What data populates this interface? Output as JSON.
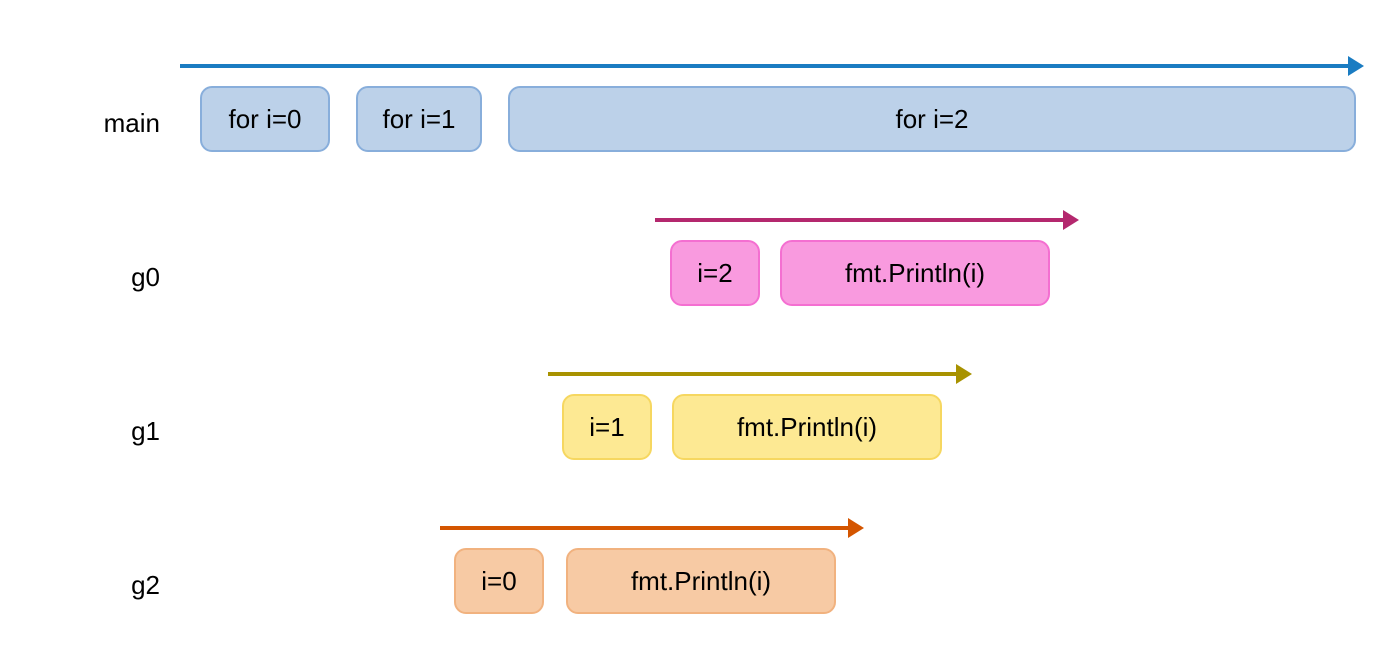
{
  "labels": {
    "main": "main",
    "g0": "g0",
    "g1": "g1",
    "g2": "g2"
  },
  "main": {
    "for0": "for i=0",
    "for1": "for i=1",
    "for2": "for i=2"
  },
  "g0": {
    "assign": "i=2",
    "call": "fmt.Println(i)"
  },
  "g1": {
    "assign": "i=1",
    "call": "fmt.Println(i)"
  },
  "g2": {
    "assign": "i=0",
    "call": "fmt.Println(i)"
  },
  "colors": {
    "main_arrow": "#1a7cc2",
    "main_box_fill": "#bcd1e9",
    "g0_arrow": "#b4286e",
    "g0_box_fill": "#f99adf",
    "g1_arrow": "#a89200",
    "g1_box_fill": "#fde993",
    "g2_arrow": "#d45500",
    "g2_box_fill": "#f7caa4"
  }
}
